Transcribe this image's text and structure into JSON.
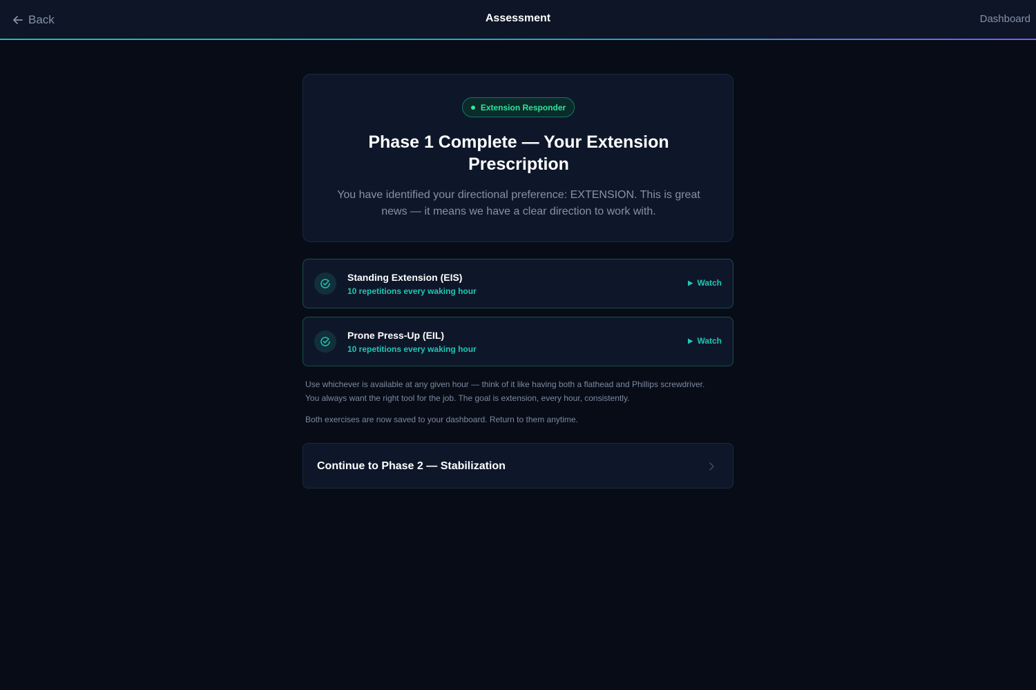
{
  "header": {
    "back_label": "Back",
    "title": "Assessment",
    "dashboard_label": "Dashboard"
  },
  "hero": {
    "badge": "Extension Responder",
    "title": "Phase 1 Complete — Your Extension Prescription",
    "description": "You have identified your directional preference: EXTENSION. This is great news — it means we have a clear direction to work with."
  },
  "exercises": [
    {
      "name": "Standing Extension (EIS)",
      "reps": "10 repetitions every waking hour",
      "watch_label": "Watch"
    },
    {
      "name": "Prone Press-Up (EIL)",
      "reps": "10 repetitions every waking hour",
      "watch_label": "Watch"
    }
  ],
  "notes": {
    "usage": "Use whichever is available at any given hour — think of it like having both a flathead and Phillips screwdriver. You always want the right tool for the job. The goal is extension, every hour, consistently.",
    "saved": "Both exercises are now saved to your dashboard. Return to them anytime."
  },
  "cta": {
    "label": "Continue to Phase 2 — Stabilization"
  },
  "colors": {
    "background": "#070c17",
    "accent_teal": "#1fc7b5",
    "accent_green": "#2ee59d",
    "accent_purple": "#7a5cf0"
  },
  "icons": {
    "back": "arrow-left-icon",
    "exercise": "check-circle-icon",
    "watch": "play-icon",
    "continue": "chevron-right-icon"
  }
}
